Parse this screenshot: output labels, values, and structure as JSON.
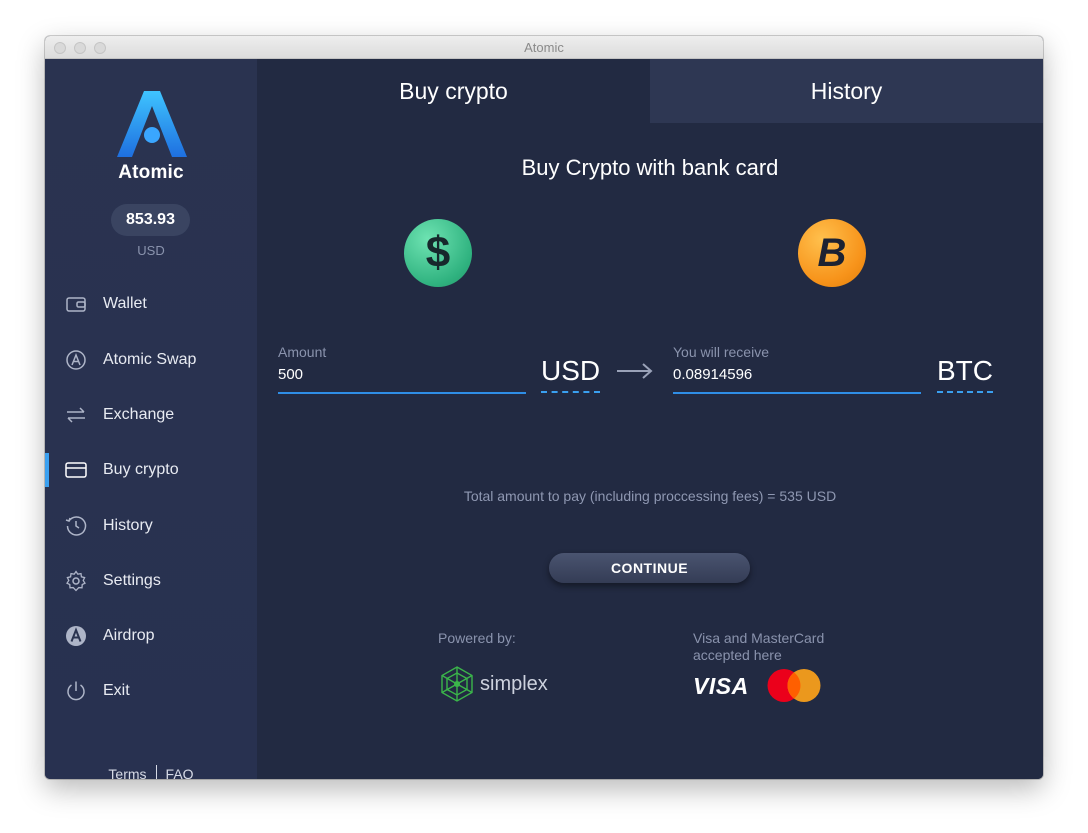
{
  "window": {
    "title": "Atomic"
  },
  "sidebar": {
    "brand": "Atomic",
    "balance": "853.93",
    "balance_currency": "USD",
    "items": [
      {
        "label": "Wallet",
        "icon": "wallet-icon"
      },
      {
        "label": "Atomic Swap",
        "icon": "atomic-swap-icon"
      },
      {
        "label": "Exchange",
        "icon": "exchange-icon"
      },
      {
        "label": "Buy crypto",
        "icon": "card-icon",
        "active": true
      },
      {
        "label": "History",
        "icon": "history-icon"
      },
      {
        "label": "Settings",
        "icon": "gear-icon"
      },
      {
        "label": "Airdrop",
        "icon": "airdrop-icon"
      },
      {
        "label": "Exit",
        "icon": "power-icon"
      }
    ],
    "footer": {
      "terms": "Terms",
      "faq": "FAQ"
    }
  },
  "tabs": {
    "buy": "Buy crypto",
    "history": "History"
  },
  "main": {
    "heading": "Buy Crypto with bank card",
    "from_coin_symbol": "$",
    "to_coin_symbol": "B",
    "amount_label": "Amount",
    "amount_value": "500",
    "amount_currency": "USD",
    "receive_label": "You will receive",
    "receive_value": "0.08914596",
    "receive_currency": "BTC",
    "total_text": "Total amount to pay (including proccessing fees) = 535 USD",
    "continue_label": "CONTINUE",
    "powered_by": "Powered by:",
    "provider": "simplex",
    "cards_text": "Visa and MasterCard accepted here",
    "visa": "VISA"
  },
  "colors": {
    "accent": "#3aa0f0",
    "background": "#222a42",
    "sidebar": "#2a3350",
    "usd_coin": "#2fb27f",
    "btc_coin": "#f7931a",
    "mastercard_red": "#eb001b",
    "mastercard_orange": "#f79e1b"
  }
}
